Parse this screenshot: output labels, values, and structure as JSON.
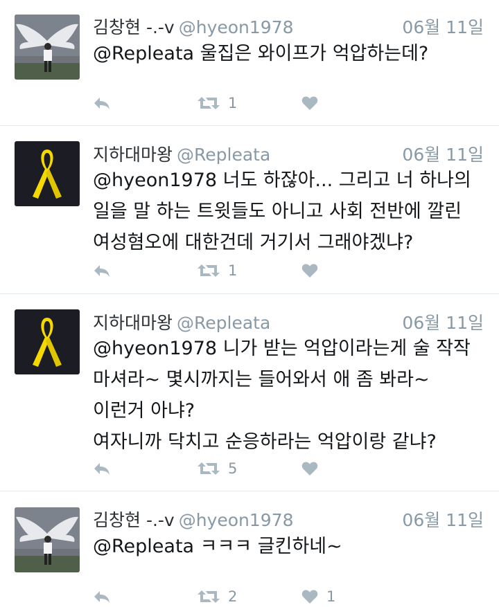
{
  "tweets": [
    {
      "display_name": "김창현 -.-v",
      "handle": "@hyeon1978",
      "date": "06월 11일",
      "avatar": "wings-mural-photo",
      "lines": [
        "@Repleata 울집은 와이프가 억압하는데?"
      ],
      "retweet_count": "1",
      "like_count": ""
    },
    {
      "display_name": "지하대마왕",
      "handle": "@Repleata",
      "date": "06월 11일",
      "avatar": "yellow-ribbon",
      "lines": [
        "@hyeon1978 너도 하잖아... 그리고 너 하나의",
        "일을 말 하는 트윗들도 아니고 사회 전반에 깔린",
        "여성혐오에 대한건데 거기서 그래야겠냐?"
      ],
      "retweet_count": "1",
      "like_count": ""
    },
    {
      "display_name": "지하대마왕",
      "handle": "@Repleata",
      "date": "06월 11일",
      "avatar": "yellow-ribbon",
      "lines": [
        "@hyeon1978 니가 받는 억압이라는게 술 작작",
        "마셔라~ 몇시까지는 들어와서 애 좀 봐라~",
        "이런거 아냐?",
        "여자니까 닥치고 순응하라는 억압이랑 같냐?"
      ],
      "retweet_count": "5",
      "like_count": ""
    },
    {
      "display_name": "김창현 -.-v",
      "handle": "@hyeon1978",
      "date": "06월 11일",
      "avatar": "wings-mural-photo",
      "lines": [
        "@Repleata ㅋㅋㅋ  글킨하네~"
      ],
      "retweet_count": "2",
      "like_count": "1"
    }
  ],
  "icons": {
    "reply": "reply-icon",
    "retweet": "retweet-icon",
    "like": "heart-icon"
  },
  "colors": {
    "name": "#292f33",
    "muted": "#8899a6",
    "icon": "#aab8c2",
    "ribbon": "#f5d800",
    "ribbon_bg": "#1b1c24",
    "divider": "#e1e8ed"
  }
}
